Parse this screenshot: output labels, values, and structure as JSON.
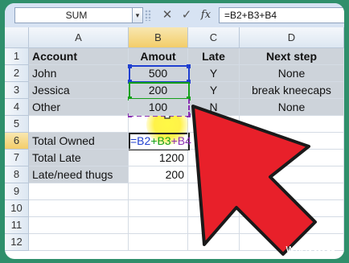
{
  "formula_bar": {
    "name_box": "SUM",
    "name_box_arrow": "▾",
    "cancel_symbol": "✕",
    "enter_symbol": "✓",
    "fx_symbol": "fx",
    "formula": "=B2+B3+B4"
  },
  "columns": [
    "A",
    "B",
    "C",
    "D"
  ],
  "row_numbers": [
    "1",
    "2",
    "3",
    "4",
    "5",
    "6",
    "7",
    "8",
    "9",
    "10",
    "11",
    "12"
  ],
  "cells": {
    "a1": "Account",
    "b1": "Amout",
    "c1": "Late",
    "d1": "Next step",
    "a2": "John",
    "b2": "500",
    "c2": "Y",
    "d2": "None",
    "a3": "Jessica",
    "b3": "200",
    "c3": "Y",
    "d3": "break kneecaps",
    "a4": "Other",
    "b4": "100",
    "c4": "N",
    "d4": "None",
    "a6": "Total Owned",
    "b6_parts": [
      "=B2",
      "+B3",
      "+B4"
    ],
    "a7": "Total Late",
    "b7": "1200",
    "a8": "Late/need thugs",
    "b8": "200"
  },
  "colors": {
    "ref_b2": "#1f3fcf",
    "ref_b3": "#14a01a",
    "ref_b4": "#8a2fb3",
    "arrow": "#e8202a",
    "header_shade": "#cdd3da",
    "background": "#2f8f6b"
  },
  "watermark": {
    "wiki": "wiki",
    "how": "How"
  }
}
